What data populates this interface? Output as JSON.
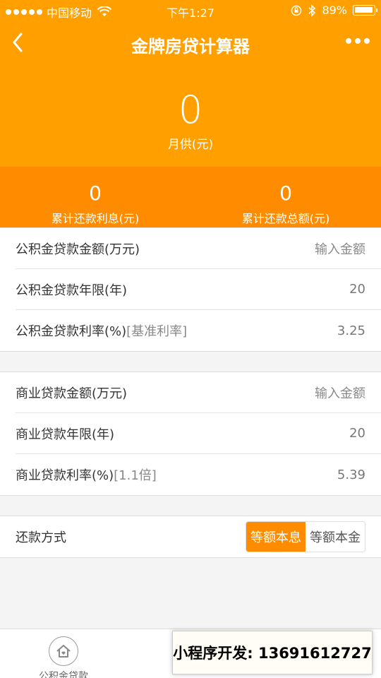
{
  "status": {
    "carrier": "中国移动",
    "time": "下午1:27",
    "battery": "89%",
    "battery_level": 0.89
  },
  "nav": {
    "title": "金牌房贷计算器"
  },
  "summary": {
    "monthly_value": "0",
    "monthly_label": "月供(元)",
    "interest_value": "0",
    "interest_label": "累计还款利息(元)",
    "total_value": "0",
    "total_label": "累计还款总额(元)"
  },
  "fund_loan": {
    "amount_label": "公积金贷款金额(万元)",
    "amount_placeholder": "输入金额",
    "years_label": "公积金贷款年限(年)",
    "years_value": "20",
    "rate_label": "公积金贷款利率(%)",
    "rate_tag": "[基准利率]",
    "rate_value": "3.25"
  },
  "commercial_loan": {
    "amount_label": "商业贷款金额(万元)",
    "amount_placeholder": "输入金额",
    "years_label": "商业贷款年限(年)",
    "years_value": "20",
    "rate_label": "商业贷款利率(%)",
    "rate_tag": "[1.1倍]",
    "rate_value": "5.39"
  },
  "repayment": {
    "label": "还款方式",
    "options": [
      "等额本息",
      "等额本金"
    ],
    "selected": "等额本息"
  },
  "tabbar": {
    "tab1": "公积金贷款"
  },
  "overlay": {
    "text": "小程序开发: 13691612727"
  },
  "colors": {
    "primary": "#ffa000",
    "accent": "#ff8c00"
  }
}
